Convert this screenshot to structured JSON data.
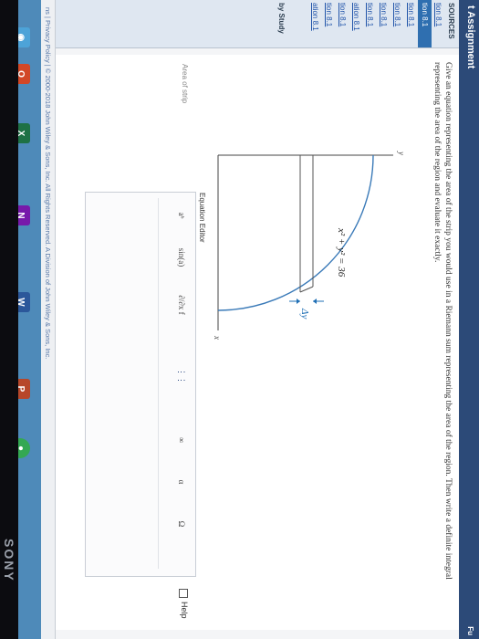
{
  "app": {
    "title": "t Assignment",
    "top_right": "Fu"
  },
  "sidebar": {
    "heading": "SOURCES",
    "items": [
      "tion 8.1",
      "tion 8.1",
      "tion 8.1",
      "tion 8.1",
      "tion 8.1",
      "tion 8.1",
      "ation 8.1",
      "tion 8.1",
      "tion 8.1",
      "ation 8.1"
    ],
    "study_label": "by Study"
  },
  "question": {
    "text": "Give an equation representing the area of the strip you would use in a Riemann sum representing the area of the region. Then write a definite integral representing the area of the region and evaluate it exactly."
  },
  "figure": {
    "y_label": "y",
    "x_label": "x",
    "equation": "x² + y² = 36",
    "delta_label": "Δy"
  },
  "editor": {
    "title": "Equation Editor",
    "toolbar": [
      "aᵇ",
      "sin(a)",
      "∂/∂x f",
      "⋮⋮",
      "∞",
      "α",
      "Ω"
    ],
    "help_label": "Help",
    "area_label": "Area of strip"
  },
  "footer": {
    "text": "ns  |  Privacy Policy  |  © 2000-2018 John Wiley & Sons, Inc. All Rights Reserved. A Division of John Wiley & Sons, Inc."
  },
  "taskbar": {
    "icons": [
      "◉",
      "O",
      "X",
      "N",
      "W",
      "P",
      "●"
    ],
    "colors": [
      "#4da3d8",
      "#d24726",
      "#1e7145",
      "#7719aa",
      "#2b579a",
      "#b7472a",
      "#34a853"
    ]
  },
  "device": {
    "brand": "SONY"
  }
}
